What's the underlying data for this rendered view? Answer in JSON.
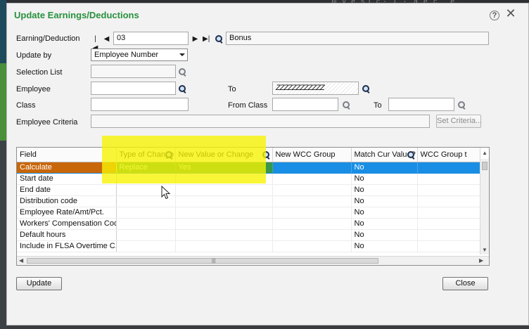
{
  "window": {
    "title": "Update Earnings/Deductions",
    "topbar_text": "... Ill...y...e...s, I...c. - ...I... - ...a...e...c... ...e..."
  },
  "form": {
    "earning_deduction": {
      "label": "Earning/Deduction",
      "code": "03",
      "description": "Bonus"
    },
    "update_by": {
      "label": "Update by",
      "value": "Employee Number"
    },
    "selection_list": {
      "label": "Selection List",
      "value": ""
    },
    "employee": {
      "label": "Employee",
      "from": "",
      "to_label": "To",
      "to": "ZZZZZZZZZZZZ"
    },
    "class": {
      "label": "Class",
      "value": "",
      "from_label": "From Class",
      "from": "",
      "to_label": "To",
      "to": ""
    },
    "employee_criteria": {
      "label": "Employee Criteria",
      "value": "",
      "button": "Set Criteria..."
    }
  },
  "grid": {
    "columns": [
      "Field",
      "Type of Change",
      "New Value or Change",
      "New WCC Group",
      "Match Cur Value?",
      "WCC Group t"
    ],
    "rows": [
      {
        "field": "Calculate",
        "type": "Replace",
        "value": "Yes",
        "wcc": "",
        "match": "No",
        "wcct": ""
      },
      {
        "field": "Start date",
        "type": "",
        "value": "",
        "wcc": "",
        "match": "No",
        "wcct": ""
      },
      {
        "field": "End date",
        "type": "",
        "value": "",
        "wcc": "",
        "match": "No",
        "wcct": ""
      },
      {
        "field": "Distribution code",
        "type": "",
        "value": "",
        "wcc": "",
        "match": "No",
        "wcct": ""
      },
      {
        "field": "Employee Rate/Amt/Pct.",
        "type": "",
        "value": "",
        "wcc": "",
        "match": "No",
        "wcct": ""
      },
      {
        "field": "Workers' Compensation Code",
        "type": "",
        "value": "",
        "wcc": "",
        "match": "No",
        "wcct": ""
      },
      {
        "field": "Default hours",
        "type": "",
        "value": "",
        "wcc": "",
        "match": "No",
        "wcct": ""
      },
      {
        "field": "Include in FLSA Overtime C...",
        "type": "",
        "value": "",
        "wcc": "",
        "match": "No",
        "wcct": ""
      }
    ],
    "selected_row": 0
  },
  "buttons": {
    "update": "Update",
    "close": "Close"
  },
  "icons": {
    "first": "first-record-icon",
    "prev": "previous-record-icon",
    "next": "next-record-icon",
    "last": "last-record-icon",
    "finder": "search-icon",
    "help": "help-icon",
    "close": "close-icon"
  },
  "colors": {
    "title": "#27913d",
    "selection": "#1a8ee4",
    "field_selected": "#c8660a",
    "highlight": "#f7f400"
  }
}
